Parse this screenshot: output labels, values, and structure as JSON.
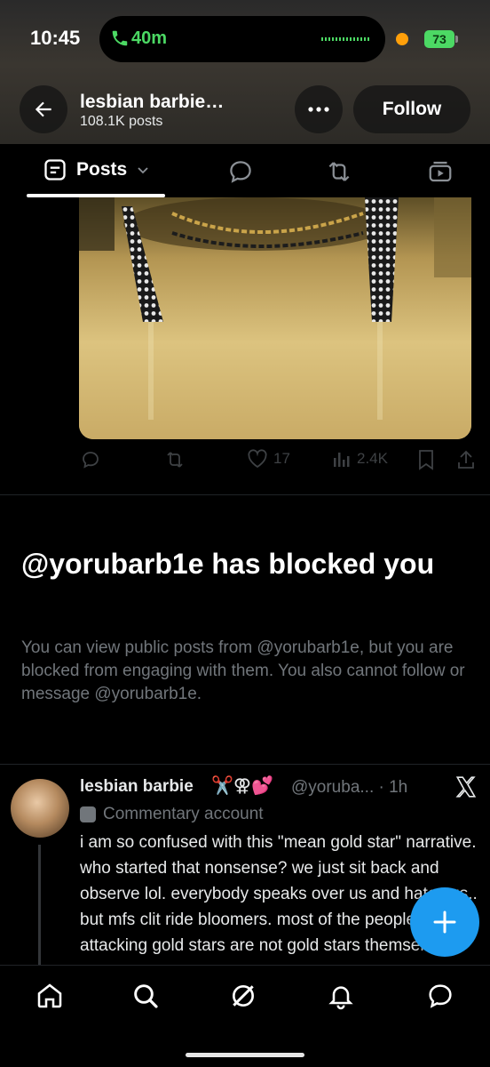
{
  "status_bar": {
    "time": "10:45",
    "call_duration": "40m",
    "battery": "73"
  },
  "header": {
    "name": "lesbian barbie…",
    "post_count": "108.1K posts",
    "follow_label": "Follow"
  },
  "tabs": {
    "active_label": "Posts",
    "items": [
      "posts-tab",
      "replies-tab",
      "reposts-tab",
      "media-tab"
    ]
  },
  "post_actions": {
    "likes": "17",
    "views": "2.4K"
  },
  "blocked": {
    "title": "@yorubarb1e has blocked you",
    "description": "You can view public posts from @yorubarb1e, but you are blocked from engaging with them. You also cannot follow or message @yorubarb1e."
  },
  "tweet": {
    "name": "lesbian barbie",
    "emojis": "✂️⚢💕",
    "handle_time": "@yoruba... · 1h",
    "label": "Commentary account",
    "body": "i am so confused with this \"mean gold star\" narrative. who started that nonsense? we just sit back and observe lol. everybody speaks over us and hates us.. but mfs clit ride bloomers. most of the people attacking gold stars are not gold stars themselves"
  },
  "colors": {
    "accent": "#1d9bf0",
    "muted_text": "#71767b",
    "call_green": "#4cd964"
  },
  "bottom_nav": [
    "home-icon",
    "search-icon",
    "grok-icon",
    "notifications-icon",
    "messages-icon"
  ]
}
